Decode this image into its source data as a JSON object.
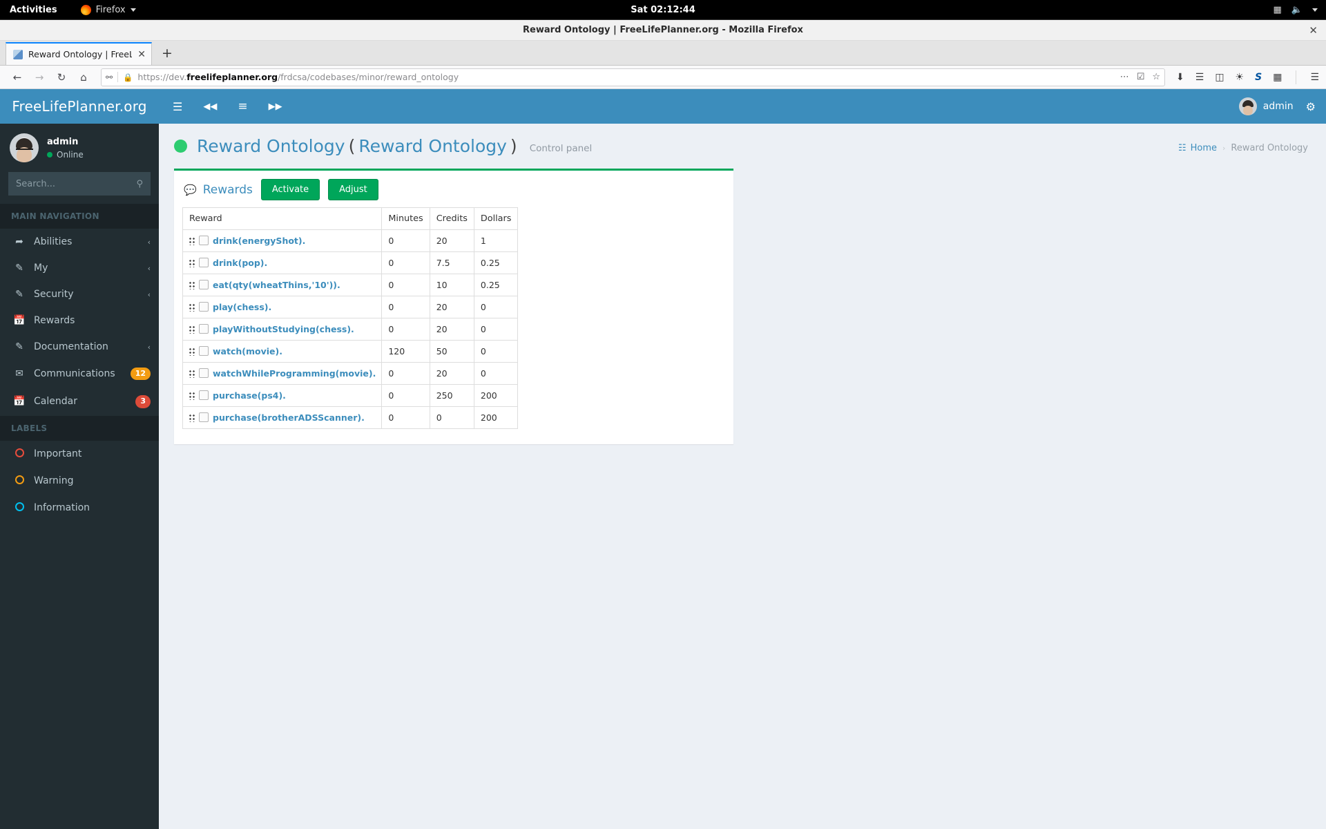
{
  "desktop": {
    "activities": "Activities",
    "app_name": "Firefox",
    "clock": "Sat 02:12:44",
    "tray": {
      "accessibility": "accessibility-icon",
      "volume": "volume-icon",
      "menu": "dropdown-arrow-icon"
    }
  },
  "browser": {
    "window_title": "Reward Ontology | FreeLifePlanner.org - Mozilla Firefox",
    "close_label": "✕",
    "tab": {
      "title": "Reward Ontology | FreeL",
      "close": "✕"
    },
    "new_tab_label": "+",
    "nav": {
      "back": "←",
      "forward": "→",
      "reload": "↻",
      "home": "⌂"
    },
    "url": {
      "scheme": "https://dev.",
      "domain": "freelifeplanner.org",
      "path": "/frdcsa/codebases/minor/reward_ontology",
      "full": "https://dev.freelifeplanner.org/frdcsa/codebases/minor/reward_ontology"
    },
    "url_actions": {
      "more": "⋯",
      "pocket": "pocket-icon",
      "bookmark": "☆"
    },
    "toolbar_icons": [
      "download-icon",
      "library-icon",
      "sidebar-icon",
      "account-icon",
      "skype-s-icon",
      "extension-icon",
      "app-menu-icon"
    ],
    "skype_letter": "S"
  },
  "sidebar": {
    "brand": "FreeLifePlanner.org",
    "user": {
      "name": "admin",
      "status": "Online"
    },
    "search_placeholder": "Search...",
    "search_value": "",
    "nav_header": "MAIN NAVIGATION",
    "items": [
      {
        "label": "Abilities",
        "icon": "share-icon",
        "chevron": "‹",
        "badge": null
      },
      {
        "label": "My",
        "icon": "edit-icon",
        "chevron": "‹",
        "badge": null
      },
      {
        "label": "Security",
        "icon": "edit-icon",
        "chevron": "‹",
        "badge": null
      },
      {
        "label": "Rewards",
        "icon": "calendar-icon",
        "chevron": "",
        "badge": null
      },
      {
        "label": "Documentation",
        "icon": "edit-icon",
        "chevron": "‹",
        "badge": null
      },
      {
        "label": "Communications",
        "icon": "envelope-icon",
        "chevron": "",
        "badge": "12",
        "badge_color": "orange"
      },
      {
        "label": "Calendar",
        "icon": "calendar-icon",
        "chevron": "",
        "badge": "3",
        "badge_color": "red"
      }
    ],
    "labels_header": "LABELS",
    "labels": [
      {
        "label": "Important",
        "color": "#e74c3c"
      },
      {
        "label": "Warning",
        "color": "#f39c12"
      },
      {
        "label": "Information",
        "color": "#00c0ef"
      }
    ]
  },
  "topnav": {
    "icons": [
      "hamburger-icon",
      "fast-backward-icon",
      "align-list-icon",
      "fast-forward-icon"
    ],
    "hamburger": "☰",
    "backward": "◀◀",
    "list": "≡",
    "forward": "▶▶",
    "user_name": "admin",
    "gear": "gears-icon"
  },
  "header": {
    "title": "Reward Ontology",
    "paren_open": "(",
    "title_alt": "Reward Ontology",
    "paren_close": ")",
    "subtitle": "Control panel",
    "breadcrumb": {
      "home": "Home",
      "separator": "›",
      "current": "Reward Ontology"
    }
  },
  "box": {
    "title": "Rewards",
    "buttons": {
      "activate": "Activate",
      "adjust": "Adjust"
    },
    "table": {
      "columns": [
        "Reward",
        "Minutes",
        "Credits",
        "Dollars"
      ],
      "rows": [
        {
          "reward": "drink(energyShot).",
          "minutes": "0",
          "credits": "20",
          "dollars": "1"
        },
        {
          "reward": "drink(pop).",
          "minutes": "0",
          "credits": "7.5",
          "dollars": "0.25"
        },
        {
          "reward": "eat(qty(wheatThins,'10')).",
          "minutes": "0",
          "credits": "10",
          "dollars": "0.25"
        },
        {
          "reward": "play(chess).",
          "minutes": "0",
          "credits": "20",
          "dollars": "0"
        },
        {
          "reward": "playWithoutStudying(chess).",
          "minutes": "0",
          "credits": "20",
          "dollars": "0"
        },
        {
          "reward": "watch(movie).",
          "minutes": "120",
          "credits": "50",
          "dollars": "0"
        },
        {
          "reward": "watchWhileProgramming(movie).",
          "minutes": "0",
          "credits": "20",
          "dollars": "0"
        },
        {
          "reward": "purchase(ps4).",
          "minutes": "0",
          "credits": "250",
          "dollars": "200"
        },
        {
          "reward": "purchase(brotherADSScanner).",
          "minutes": "0",
          "credits": "0",
          "dollars": "200"
        }
      ]
    }
  },
  "colors": {
    "brand_blue": "#3c8dbc",
    "sidebar_dark": "#222d32",
    "accent_green": "#00a65a",
    "page_bg": "#ecf0f5"
  }
}
